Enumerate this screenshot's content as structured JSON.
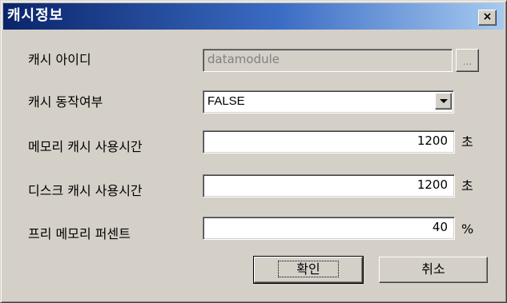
{
  "window": {
    "title": "캐시정보",
    "close_label": "×"
  },
  "form": {
    "cache_id": {
      "label": "캐시 아이디",
      "value": "datamodule",
      "browse_label": "..."
    },
    "cache_enabled": {
      "label": "캐시 동작여부",
      "value": "FALSE"
    },
    "memory_cache_time": {
      "label": "메모리 캐시 사용시간",
      "value": "1200",
      "unit": "초"
    },
    "disk_cache_time": {
      "label": "디스크 캐시 사용시간",
      "value": "1200",
      "unit": "초"
    },
    "free_memory_percent": {
      "label": "프리 메모리 퍼센트",
      "value": "40",
      "unit": "%"
    }
  },
  "buttons": {
    "ok_label": "확인",
    "cancel_label": "취소"
  }
}
